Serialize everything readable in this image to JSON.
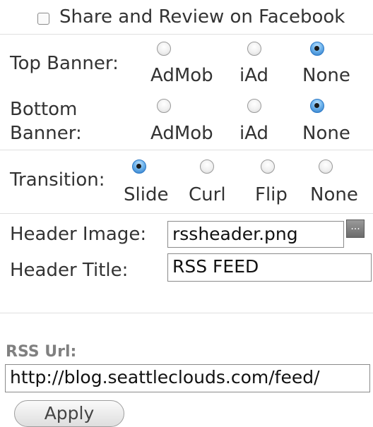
{
  "share": {
    "label": "Share and Review on Facebook",
    "checked": false
  },
  "top_banner": {
    "label": "Top Banner:",
    "options": [
      "AdMob",
      "iAd",
      "None"
    ],
    "selected": "None"
  },
  "bottom_banner": {
    "label_line1": "Bottom",
    "label_line2": "Banner:",
    "options": [
      "AdMob",
      "iAd",
      "None"
    ],
    "selected": "None"
  },
  "transition": {
    "label": "Transition:",
    "options": [
      "Slide",
      "Curl",
      "Flip",
      "None"
    ],
    "selected": "Slide"
  },
  "header_image": {
    "label": "Header Image:",
    "value": "rssheader.png",
    "browse": "..."
  },
  "header_title": {
    "label": "Header Title:",
    "value": "RSS FEED"
  },
  "rss": {
    "label": "RSS Url:",
    "value": "http://blog.seattleclouds.com/feed/"
  },
  "apply": {
    "label": "Apply"
  },
  "colors": {
    "radio_selected": "#2b78c6",
    "text": "#333333",
    "rss_label": "#808080"
  }
}
